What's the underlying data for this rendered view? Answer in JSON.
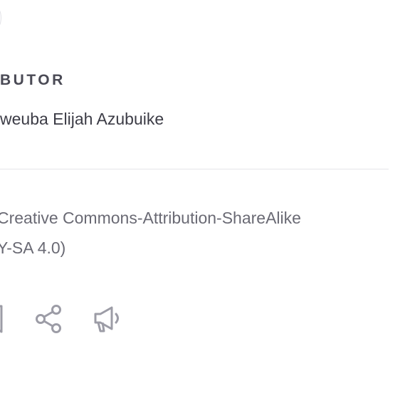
{
  "contributor": {
    "label": "BUTOR",
    "name": "weuba Elijah Azubuike"
  },
  "license": {
    "line1": "Creative Commons-Attribution-ShareAlike",
    "line2": "Y-SA 4.0)"
  },
  "actions": [
    {
      "icon": "bookmark-icon"
    },
    {
      "icon": "share-icon"
    },
    {
      "icon": "megaphone-icon"
    }
  ],
  "colors": {
    "icon": "#9c9ca6",
    "label": "#4a4a55",
    "text": "#3c3c46",
    "muted_text": "#6a6a74",
    "divider": "#e4e4e8"
  }
}
